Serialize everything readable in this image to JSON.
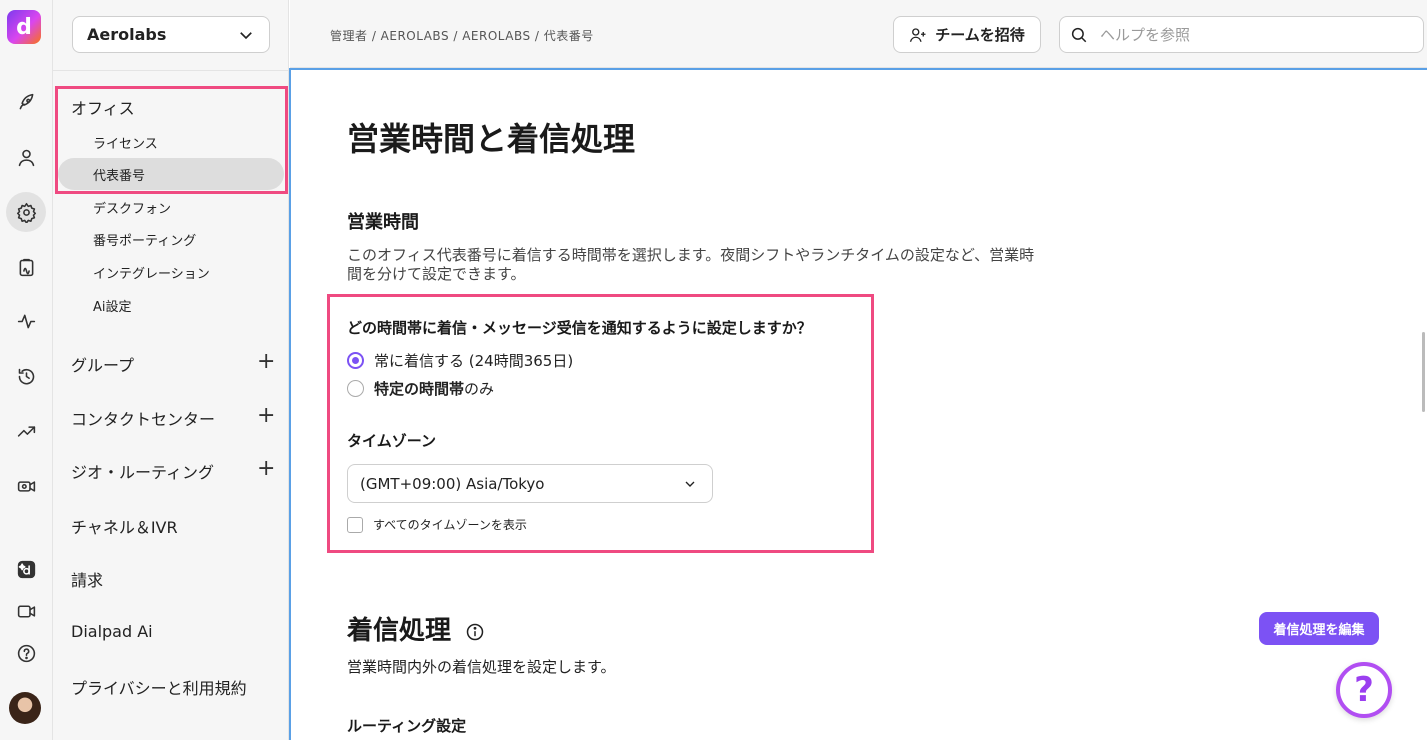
{
  "rail": {
    "logo_letter": "d",
    "icons": [
      "rocket-icon",
      "user-icon",
      "gear-icon",
      "clipboard-icon",
      "activity-icon",
      "history-icon",
      "trend-icon",
      "camera-gear-icon",
      "dialpad-ai-icon",
      "video-icon",
      "help-circle-icon",
      "avatar"
    ]
  },
  "sidebar": {
    "org": "Aerolabs",
    "office_label": "オフィス",
    "office_items": [
      "ライセンス",
      "代表番号",
      "デスクフォン",
      "番号ポーティング",
      "インテグレーション",
      "Ai設定"
    ],
    "sections": [
      {
        "label": "グループ",
        "plus": "+"
      },
      {
        "label": "コンタクトセンター",
        "plus": "+"
      },
      {
        "label": "ジオ・ルーティング",
        "plus": "+"
      },
      {
        "label": "チャネル＆IVR"
      },
      {
        "label": "請求"
      },
      {
        "label": "Dialpad Ai"
      },
      {
        "label": "プライバシーと利用規約"
      }
    ]
  },
  "topbar": {
    "breadcrumb": "管理者 / AEROLABS / AEROLABS / 代表番号",
    "invite_label": "チームを招待",
    "search_placeholder": "ヘルプを参照"
  },
  "main": {
    "title": "営業時間と着信処理",
    "business_hours_title": "営業時間",
    "business_hours_desc": "このオフィス代表番号に着信する時間帯を選択します。夜間シフトやランチタイムの設定など、営業時間を分けて設定できます。",
    "question": "どの時間帯に着信・メッセージ受信を通知するように設定しますか？",
    "option_always": "常に着信する (24時間365日)",
    "option_specific_bold": "特定の時間帯",
    "option_specific_rest": "のみ",
    "timezone_label": "タイムゾーン",
    "timezone_value": "(GMT+09:00) Asia/Tokyo",
    "show_all_tz": "すべてのタイムゾーンを表示",
    "call_handling_title": "着信処理",
    "edit_button": "着信処理を編集",
    "call_handling_desc": "営業時間内外の着信処理を設定します。",
    "routing_title": "ルーティング設定",
    "help_fab": "?"
  },
  "colors": {
    "accent": "#7c52f4",
    "highlight": "#ef4a81",
    "focus_border": "#5aa0e6"
  }
}
